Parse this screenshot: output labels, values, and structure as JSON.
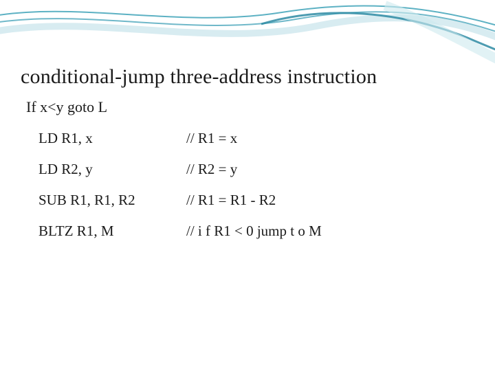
{
  "title": "conditional-jump three-address instruction",
  "subtitle": "If x<y goto L",
  "rows": [
    {
      "instr": "LD R1, x",
      "comment": "// R1 = x"
    },
    {
      "instr": "LD R2, y",
      "comment": "// R2 = y"
    },
    {
      "instr": "SUB R1, R1, R2",
      "comment": "// R1 = R1 - R2"
    },
    {
      "instr": "BLTZ R1, M",
      "comment": "// i f R1 < 0 jump t o M"
    }
  ]
}
